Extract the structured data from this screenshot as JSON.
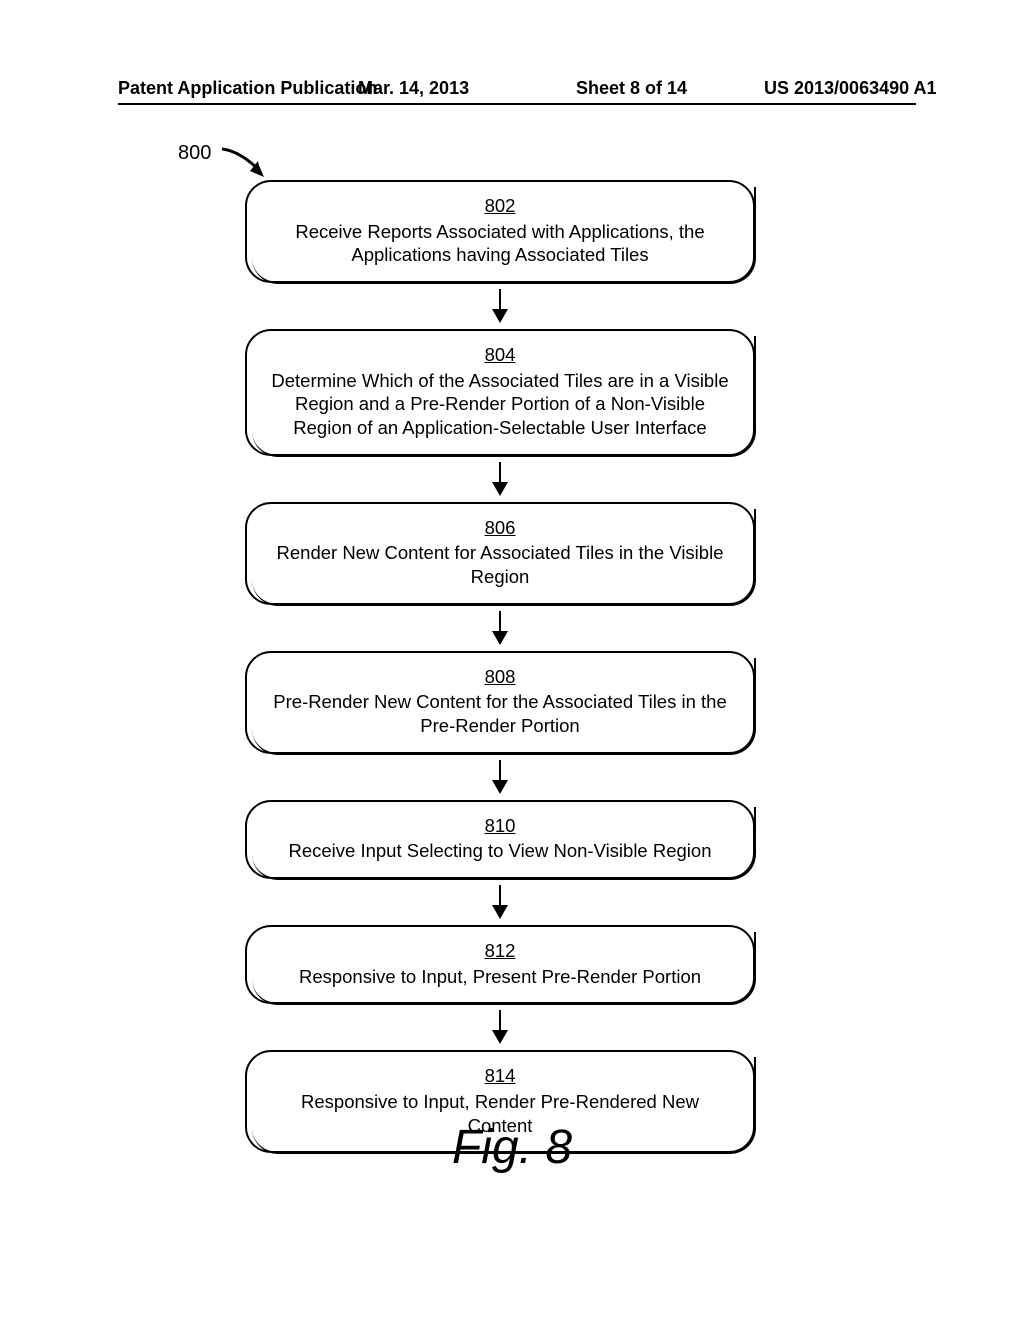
{
  "header": {
    "left": "Patent Application Publication",
    "center": "Mar. 14, 2013",
    "right": "Sheet 8 of 14",
    "pub": "US 2013/0063490 A1"
  },
  "figure_ref": "800",
  "steps": [
    {
      "num": "802",
      "text": "Receive Reports Associated with Applications, the Applications having Associated Tiles"
    },
    {
      "num": "804",
      "text": "Determine Which of the Associated Tiles are in a Visible Region and a Pre-Render Portion of a Non-Visible Region of an Application-Selectable User Interface"
    },
    {
      "num": "806",
      "text": "Render New Content for Associated Tiles in the Visible Region"
    },
    {
      "num": "808",
      "text": "Pre-Render New Content for the Associated Tiles in the Pre-Render Portion"
    },
    {
      "num": "810",
      "text": "Receive Input Selecting to View Non-Visible Region"
    },
    {
      "num": "812",
      "text": "Responsive to Input, Present Pre-Render Portion"
    },
    {
      "num": "814",
      "text": "Responsive to Input, Render Pre-Rendered New Content"
    }
  ],
  "caption": "Fig. 8",
  "chart_data": {
    "type": "flowchart",
    "direction": "top-to-bottom",
    "nodes": [
      {
        "id": "802",
        "label": "Receive Reports Associated with Applications, the Applications having Associated Tiles"
      },
      {
        "id": "804",
        "label": "Determine Which of the Associated Tiles are in a Visible Region and a Pre-Render Portion of a Non-Visible Region of an Application-Selectable User Interface"
      },
      {
        "id": "806",
        "label": "Render New Content for Associated Tiles in the Visible Region"
      },
      {
        "id": "808",
        "label": "Pre-Render New Content for the Associated Tiles in the Pre-Render Portion"
      },
      {
        "id": "810",
        "label": "Receive Input Selecting to View Non-Visible Region"
      },
      {
        "id": "812",
        "label": "Responsive to Input, Present Pre-Render Portion"
      },
      {
        "id": "814",
        "label": "Responsive to Input, Render Pre-Rendered New Content"
      }
    ],
    "edges": [
      {
        "from": "802",
        "to": "804"
      },
      {
        "from": "804",
        "to": "806"
      },
      {
        "from": "806",
        "to": "808"
      },
      {
        "from": "808",
        "to": "810"
      },
      {
        "from": "810",
        "to": "812"
      },
      {
        "from": "812",
        "to": "814"
      }
    ],
    "entry_reference": "800"
  }
}
